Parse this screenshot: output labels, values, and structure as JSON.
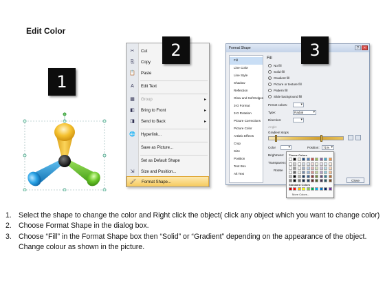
{
  "title": "Edit Color",
  "badges": [
    "1",
    "2",
    "3"
  ],
  "context_menu": {
    "items": [
      {
        "label": "Cut",
        "icon": "scissors-icon",
        "glyph": "✂"
      },
      {
        "label": "Copy",
        "icon": "copy-icon",
        "glyph": "⎘"
      },
      {
        "label": "Paste",
        "icon": "paste-icon",
        "glyph": "📋"
      },
      {
        "label": "Edit Text",
        "icon": "text-icon",
        "glyph": "A"
      },
      {
        "label": "Group",
        "icon": "group-icon",
        "glyph": "▦"
      },
      {
        "label": "Bring to Front",
        "icon": "bring-front-icon",
        "glyph": "◧"
      },
      {
        "label": "Send to Back",
        "icon": "send-back-icon",
        "glyph": "◨"
      },
      {
        "label": "Hyperlink...",
        "icon": "hyperlink-icon",
        "glyph": "🌐"
      },
      {
        "label": "Save as Picture...",
        "icon": "",
        "glyph": ""
      },
      {
        "label": "Set as Default Shape",
        "icon": "",
        "glyph": ""
      },
      {
        "label": "Size and Position...",
        "icon": "size-position-icon",
        "glyph": "⇲"
      },
      {
        "label": "Format Shape...",
        "icon": "format-shape-icon",
        "glyph": "🖌"
      }
    ]
  },
  "dialog": {
    "title": "Format Shape",
    "nav": [
      "Fill",
      "Line Color",
      "Line Style",
      "Shadow",
      "Reflection",
      "Glow and Soft Edges",
      "3-D Format",
      "3-D Rotation",
      "Picture Corrections",
      "Picture Color",
      "Artistic Effects",
      "Crop",
      "Size",
      "Position",
      "Text Box",
      "Alt Text"
    ],
    "section": "Fill",
    "radios": [
      "No fill",
      "Solid fill",
      "Gradient fill",
      "Picture or texture fill",
      "Pattern fill",
      "Slide background fill"
    ],
    "preset_label": "Preset colors:",
    "type_label": "Type:",
    "type_value": "Radial",
    "direction_label": "Direction:",
    "angle_label": "Angle:",
    "stops_label": "Gradient stops",
    "color_label": "Color",
    "position_label": "Position:",
    "position_value": "71%",
    "brightness_label": "Brightness:",
    "transparency_label": "Transparency:",
    "rotate_label": "Rotate",
    "close_label": "Close"
  },
  "palette": {
    "theme_label": "Theme Colors",
    "standard_label": "Standard Colors",
    "more_label": "More Colors...",
    "theme_row": [
      "#ffffff",
      "#000000",
      "#eeece1",
      "#1f497d",
      "#4f81bd",
      "#c0504d",
      "#9bbb59",
      "#8064a2",
      "#4bacc6",
      "#f79646"
    ],
    "standard_row": [
      "#c00000",
      "#ff0000",
      "#ffc000",
      "#ffff00",
      "#92d050",
      "#00b050",
      "#00b0f0",
      "#0070c0",
      "#002060",
      "#7030a0"
    ]
  },
  "colors": {
    "arm_top": "#f2b21c",
    "arm_left": "#2196d9",
    "arm_right": "#5ec21e",
    "hub": "#1c1c1c",
    "menu_highlight": "#f6c95c"
  },
  "instructions": [
    {
      "num": "1.",
      "text": "Select the shape to change the color and Right click the object( click any object which you want to change color)"
    },
    {
      "num": "2.",
      "text": "Choose Format Shape in the dialog box."
    },
    {
      "num": "3.",
      "text": "Choose “Fill” in the Format Shape box then “Solid” or “Gradient” depending on the appearance of the object. Change colour as shown in the picture."
    }
  ]
}
